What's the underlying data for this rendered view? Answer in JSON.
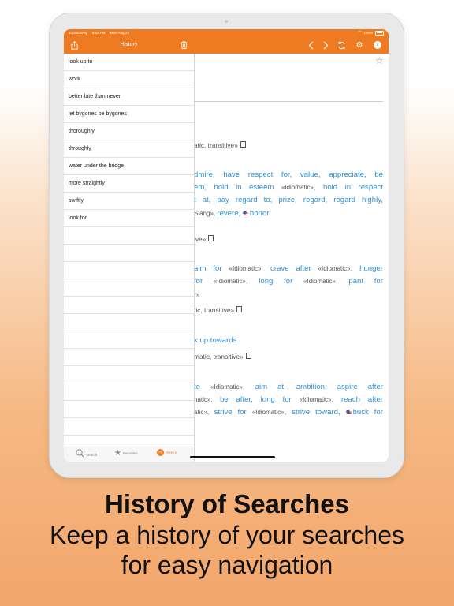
{
  "status_bar": {
    "back_app": "◂ Dictionary",
    "time": "6:54 PM",
    "date": "Mon Aug 24",
    "battery": "100%"
  },
  "navbar": {
    "title": "History",
    "icons": [
      "share-icon",
      "trash-icon",
      "back-arrow-icon",
      "forward-arrow-icon",
      "refresh-icon",
      "gear-icon",
      "info-icon"
    ],
    "info_label": "i"
  },
  "history": {
    "items": [
      "look up to",
      "work",
      "better late than never",
      "let bygones be bygones",
      "thoroughly",
      "throughly",
      "water under the bridge",
      "more straightly",
      "swiftly",
      "look for"
    ],
    "empty_rows": 13
  },
  "tabs": [
    {
      "label": "Search",
      "icon": "search-icon"
    },
    {
      "label": "Favorites",
      "icon": "star-icon"
    },
    {
      "label": "History",
      "icon": "history-icon",
      "active": true
    }
  ],
  "entry": {
    "l1": {
      "text": "atic, transitive»"
    },
    "l2": {
      "text": "dmire, have respect for, value, appreciate, be"
    },
    "l3a": {
      "text": "em, hold in esteem "
    },
    "l3b": {
      "text": "«Idiomatic»"
    },
    "l3c": {
      "text": ", hold in respect"
    },
    "l4": {
      "text": "t at, pay regard to, prize, regard, regard highly,"
    },
    "l5a": {
      "text": "Slang», "
    },
    "l5b": {
      "text": "revere, "
    },
    "l5c": {
      "text": "honor"
    },
    "l6": {
      "text": "ive»"
    },
    "l7a": {
      "text": "aim for "
    },
    "l7b": {
      "text": "«Idiomatic»"
    },
    "l7c": {
      "text": ", crave after "
    },
    "l7d": {
      "text": "«Idiomatic»"
    },
    "l7e": {
      "text": ", hunger"
    },
    "l8a": {
      "text": "for "
    },
    "l8b": {
      "text": "«Idiomatic»"
    },
    "l8c": {
      "text": ", long for "
    },
    "l8d": {
      "text": "«Idiomatic»"
    },
    "l8e": {
      "text": ", pant for"
    },
    "l9": {
      "text": "r»"
    },
    "l10": {
      "text": "tic, transitive»"
    },
    "l11": {
      "text": "k up towards"
    },
    "l12": {
      "text": "matic, transitive»"
    },
    "l13a": {
      "text": "to "
    },
    "l13b": {
      "text": "«Idiomatic»"
    },
    "l13c": {
      "text": ", aim at, ambition, aspire after"
    },
    "l14a": {
      "text": "natic», "
    },
    "l14b": {
      "text": "be after, long for "
    },
    "l14c": {
      "text": "«Idiomatic»"
    },
    "l14d": {
      "text": ", reach after"
    },
    "l15a": {
      "text": "atic», "
    },
    "l15b": {
      "text": "strive for "
    },
    "l15c": {
      "text": "«Idiomatic»"
    },
    "l15d": {
      "text": ", strive toward, "
    },
    "l15e": {
      "text": "buck for"
    }
  },
  "caption": {
    "title": "History of Searches",
    "line1": "Keep a history of your searches",
    "line2": "for easy navigation"
  },
  "colors": {
    "accent": "#ee7a22",
    "link": "#2f8fd0"
  }
}
